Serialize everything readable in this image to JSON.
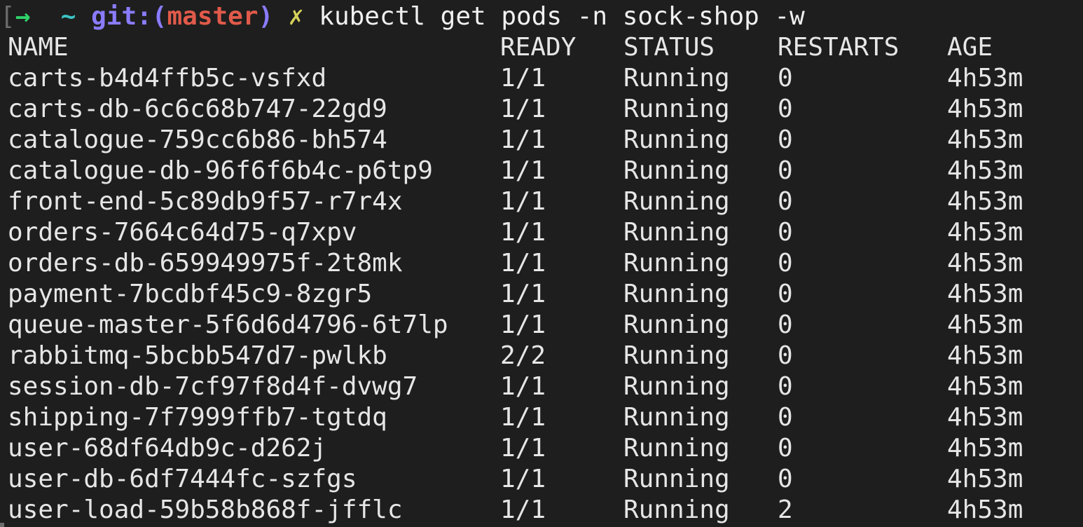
{
  "prompt": {
    "open_bracket": "[",
    "arrow": "→",
    "tilde": "~",
    "git_label": "git:(",
    "branch": "master",
    "git_close": ")",
    "dirty_mark": "✗",
    "command": "kubectl get pods -n sock-shop -w"
  },
  "table": {
    "headers": {
      "name": "NAME",
      "ready": "READY",
      "status": "STATUS",
      "restarts": "RESTARTS",
      "age": "AGE"
    },
    "rows": [
      {
        "name": "carts-b4d4ffb5c-vsfxd",
        "ready": "1/1",
        "status": "Running",
        "restarts": "0",
        "age": "4h53m"
      },
      {
        "name": "carts-db-6c6c68b747-22gd9",
        "ready": "1/1",
        "status": "Running",
        "restarts": "0",
        "age": "4h53m"
      },
      {
        "name": "catalogue-759cc6b86-bh574",
        "ready": "1/1",
        "status": "Running",
        "restarts": "0",
        "age": "4h53m"
      },
      {
        "name": "catalogue-db-96f6f6b4c-p6tp9",
        "ready": "1/1",
        "status": "Running",
        "restarts": "0",
        "age": "4h53m"
      },
      {
        "name": "front-end-5c89db9f57-r7r4x",
        "ready": "1/1",
        "status": "Running",
        "restarts": "0",
        "age": "4h53m"
      },
      {
        "name": "orders-7664c64d75-q7xpv",
        "ready": "1/1",
        "status": "Running",
        "restarts": "0",
        "age": "4h53m"
      },
      {
        "name": "orders-db-659949975f-2t8mk",
        "ready": "1/1",
        "status": "Running",
        "restarts": "0",
        "age": "4h53m"
      },
      {
        "name": "payment-7bcdbf45c9-8zgr5",
        "ready": "1/1",
        "status": "Running",
        "restarts": "0",
        "age": "4h53m"
      },
      {
        "name": "queue-master-5f6d6d4796-6t7lp",
        "ready": "1/1",
        "status": "Running",
        "restarts": "0",
        "age": "4h53m"
      },
      {
        "name": "rabbitmq-5bcbb547d7-pwlkb",
        "ready": "2/2",
        "status": "Running",
        "restarts": "0",
        "age": "4h53m"
      },
      {
        "name": "session-db-7cf97f8d4f-dvwg7",
        "ready": "1/1",
        "status": "Running",
        "restarts": "0",
        "age": "4h53m"
      },
      {
        "name": "shipping-7f7999ffb7-tgtdq",
        "ready": "1/1",
        "status": "Running",
        "restarts": "0",
        "age": "4h53m"
      },
      {
        "name": "user-68df64db9c-d262j",
        "ready": "1/1",
        "status": "Running",
        "restarts": "0",
        "age": "4h53m"
      },
      {
        "name": "user-db-6df7444fc-szfgs",
        "ready": "1/1",
        "status": "Running",
        "restarts": "0",
        "age": "4h53m"
      },
      {
        "name": "user-load-59b58b868f-jfflc",
        "ready": "1/1",
        "status": "Running",
        "restarts": "2",
        "age": "4h53m"
      }
    ]
  },
  "colors": {
    "background": "#1e1e1e",
    "text": "#e6e6e6",
    "arrow": "#2fd36a",
    "tilde": "#3cc3c3",
    "git": "#8a7cff",
    "branch": "#e15a4a",
    "dirty_mark": "#d5d25a"
  }
}
